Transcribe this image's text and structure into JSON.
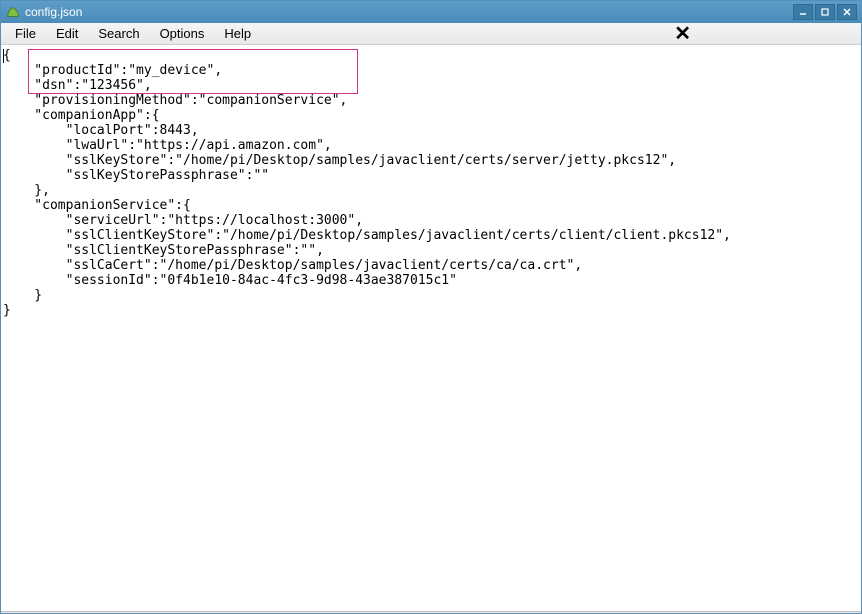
{
  "title": "config.json",
  "menu": {
    "file": "File",
    "edit": "Edit",
    "search": "Search",
    "options": "Options",
    "help": "Help"
  },
  "winctl": {
    "min": "_",
    "max": "□",
    "close": "×"
  },
  "code": {
    "l1": "{",
    "l2": "    \"productId\":\"my_device\",",
    "l3": "    \"dsn\":\"123456\",",
    "l4": "    \"provisioningMethod\":\"companionService\",",
    "l5": "    \"companionApp\":{",
    "l6": "        \"localPort\":8443,",
    "l7": "        \"lwaUrl\":\"https://api.amazon.com\",",
    "l8": "        \"sslKeyStore\":\"/home/pi/Desktop/samples/javaclient/certs/server/jetty.pkcs12\",",
    "l9": "        \"sslKeyStorePassphrase\":\"\"",
    "l10": "    },",
    "l11": "    \"companionService\":{",
    "l12": "        \"serviceUrl\":\"https://localhost:3000\",",
    "l13": "        \"sslClientKeyStore\":\"/home/pi/Desktop/samples/javaclient/certs/client/client.pkcs12\",",
    "l14": "        \"sslClientKeyStorePassphrase\":\"\",",
    "l15": "        \"sslCaCert\":\"/home/pi/Desktop/samples/javaclient/certs/ca/ca.crt\",",
    "l16": "        \"sessionId\":\"0f4b1e10-84ac-4fc3-9d98-43ae387015c1\"",
    "l17": "    }",
    "l18": "}"
  }
}
